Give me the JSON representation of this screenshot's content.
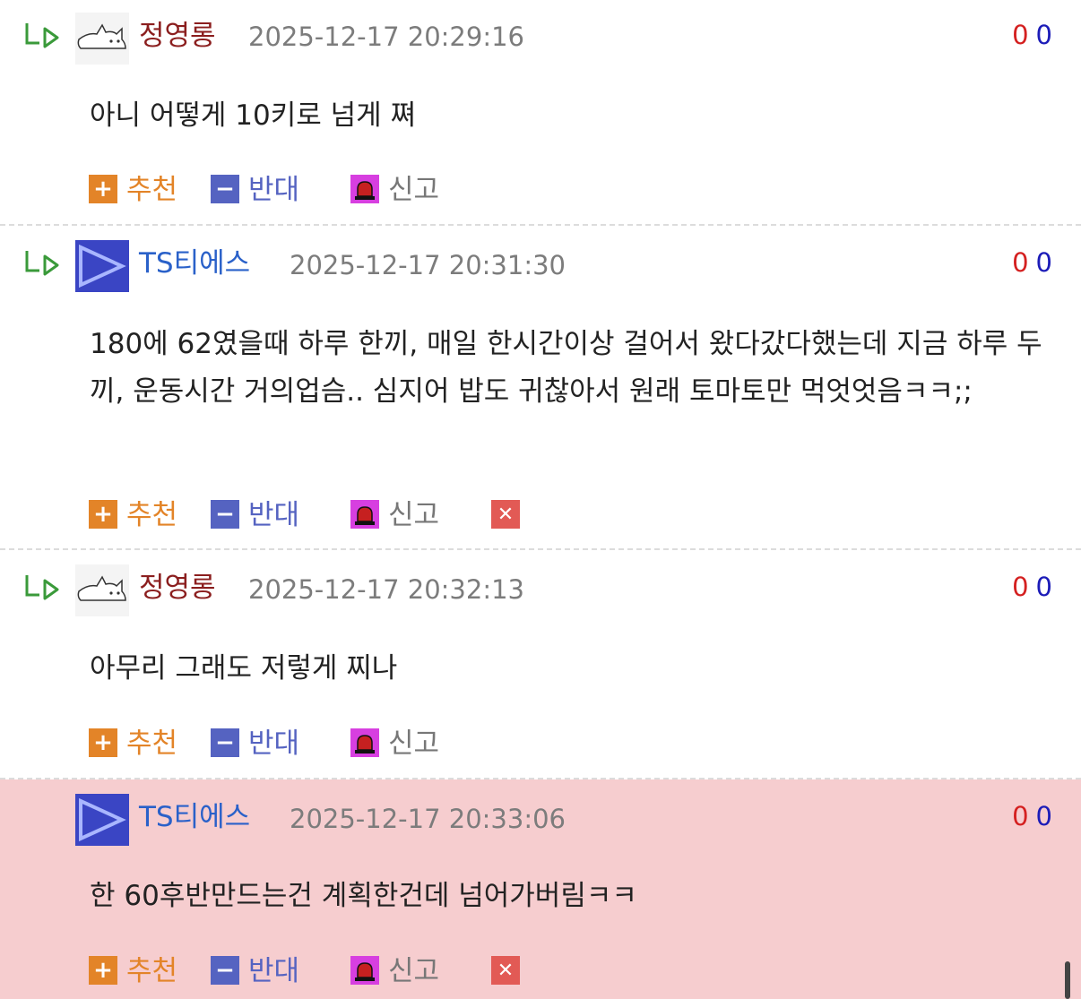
{
  "actions": {
    "recommend": "추천",
    "oppose": "반대",
    "report": "신고"
  },
  "comments": [
    {
      "author": "정영롱",
      "time": "2025-12-17 20:29:16",
      "up": "0",
      "down": "0",
      "text": "아니 어떻게 10키로 넘게 쪄"
    },
    {
      "author": "TS티에스",
      "time": "2025-12-17 20:31:30",
      "up": "0",
      "down": "0",
      "text": "180에 62였을때 하루 한끼, 매일 한시간이상 걸어서 왔다갔다했는데 지금 하루 두끼, 운동시간 거의업슴.. 심지어 밥도 귀찮아서 원래 토마토만 먹엇엇음ㅋㅋ;;"
    },
    {
      "author": "정영롱",
      "time": "2025-12-17 20:32:13",
      "up": "0",
      "down": "0",
      "text": "아무리 그래도 저렇게 찌나"
    },
    {
      "author": "TS티에스",
      "time": "2025-12-17 20:33:06",
      "up": "0",
      "down": "0",
      "text": "한 60후반만드는건 계획한건데 넘어가버림ㅋㅋ"
    }
  ]
}
